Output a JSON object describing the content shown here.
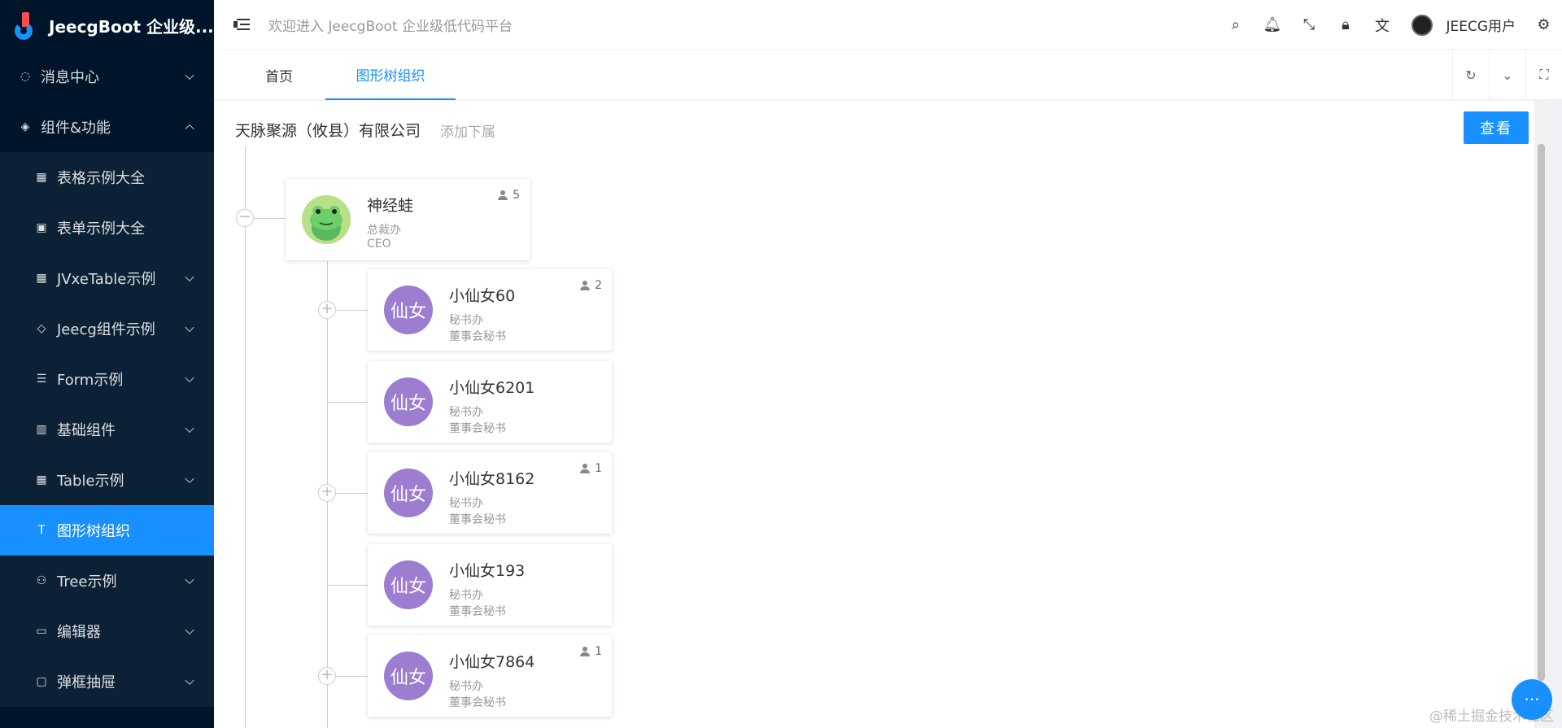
{
  "app": {
    "logo_text": "JeecgBoot 企业级..."
  },
  "sidebar": {
    "items": [
      {
        "label": "消息中心",
        "icon": "message-icon"
      },
      {
        "label": "组件&功能",
        "icon": "layers-icon"
      },
      {
        "label": "表格示例大全",
        "icon": "table-icon"
      },
      {
        "label": "表单示例大全",
        "icon": "form-icon"
      },
      {
        "label": "JVxeTable示例",
        "icon": "table-icon"
      },
      {
        "label": "Jeecg组件示例",
        "icon": "diamond-icon"
      },
      {
        "label": "Form示例",
        "icon": "form-list-icon"
      },
      {
        "label": "基础组件",
        "icon": "columns-icon"
      },
      {
        "label": "Table示例",
        "icon": "table-icon"
      },
      {
        "label": "图形树组织",
        "icon": "text-icon"
      },
      {
        "label": "Tree示例",
        "icon": "tree-icon"
      },
      {
        "label": "编辑器",
        "icon": "editor-icon"
      },
      {
        "label": "弹框抽屉",
        "icon": "laptop-icon"
      }
    ]
  },
  "header": {
    "welcome": "欢迎进入 JeecgBoot 企业级低代码平台",
    "username": "JEECG用户"
  },
  "tabs": [
    {
      "label": "首页"
    },
    {
      "label": "图形树组织"
    }
  ],
  "org": {
    "title": "天脉聚源（攸县）有限公司",
    "add_label": "添加下属",
    "view_label": "查看"
  },
  "cards": [
    {
      "name": "神经蛙",
      "dept": "总裁办",
      "post": "CEO",
      "count": "5",
      "avatar_text": ""
    },
    {
      "name": "小仙女60",
      "dept": "秘书办",
      "post": "董事会秘书",
      "count": "2",
      "avatar_text": "仙女"
    },
    {
      "name": "小仙女6201",
      "dept": "秘书办",
      "post": "董事会秘书",
      "count": "",
      "avatar_text": "仙女"
    },
    {
      "name": "小仙女8162",
      "dept": "秘书办",
      "post": "董事会秘书",
      "count": "1",
      "avatar_text": "仙女"
    },
    {
      "name": "小仙女193",
      "dept": "秘书办",
      "post": "董事会秘书",
      "count": "",
      "avatar_text": "仙女"
    },
    {
      "name": "小仙女7864",
      "dept": "秘书办",
      "post": "董事会秘书",
      "count": "1",
      "avatar_text": "仙女"
    }
  ],
  "watermark": "@稀土掘金技术社区",
  "colors": {
    "sidebar_bg": "#001529",
    "accent": "#1890ff",
    "avatar_purple": "#9c7dd0"
  }
}
